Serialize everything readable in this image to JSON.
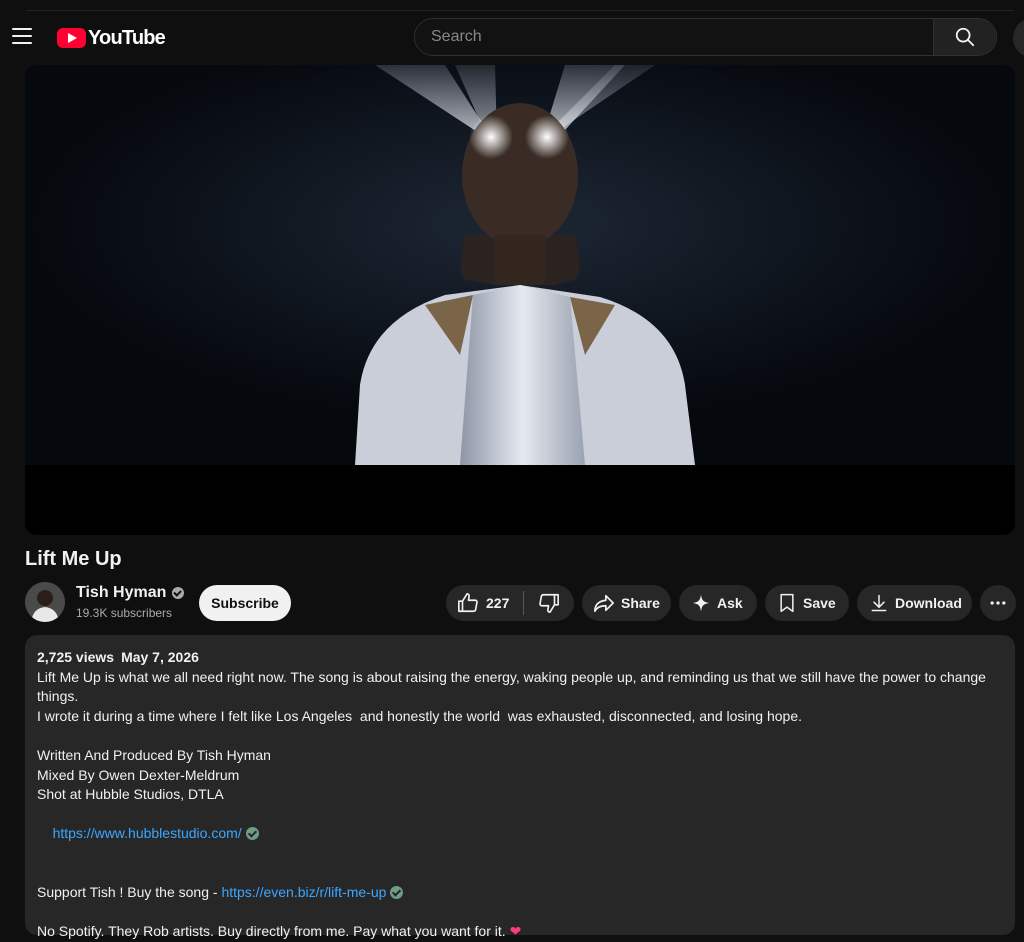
{
  "header": {
    "logo_text": "YouTube",
    "search_placeholder": "Search"
  },
  "video": {
    "title": "Lift Me Up"
  },
  "channel": {
    "name": "Tish Hyman",
    "subscribers": "19.3K subscribers",
    "subscribe_label": "Subscribe"
  },
  "actions": {
    "likes": "227",
    "share": "Share",
    "ask": "Ask",
    "save": "Save",
    "download": "Download"
  },
  "description": {
    "views": "2,725 views",
    "date": "May 7, 2026",
    "paragraph_1": "Lift Me Up is what we all need right now. The song is about raising the energy, waking people up, and reminding us that we still have the power to change things.",
    "paragraph_2": "I wrote it during a time where I felt like Los Angeles  and honestly the world  was exhausted, disconnected, and losing hope.",
    "credit_1": "Written And Produced By Tish Hyman",
    "credit_2": "Mixed By Owen Dexter-Meldrum",
    "credit_3": "Shot at Hubble Studios, DTLA",
    "link_1": "https://www.hubblestudio.com/",
    "support_text": "Support Tish ! Buy the song - ",
    "link_2": "https://even.biz/r/lift-me-up",
    "closing": "No Spotify. They Rob artists. Buy directly from me. Pay what you want for it."
  },
  "icons": {
    "menu": "menu-icon",
    "search": "search-icon",
    "like": "thumbs-up-icon",
    "dislike": "thumbs-down-icon",
    "share": "share-arrow-icon",
    "ask": "sparkle-icon",
    "save": "bookmark-icon",
    "download": "download-icon",
    "more": "more-horizontal-icon",
    "verified": "verified-check-icon",
    "heart": "heart-emoji"
  },
  "colors": {
    "background": "#0f0f0f",
    "surface": "#272727",
    "brand_red": "#ff0033",
    "link_blue": "#3ea6ff"
  }
}
